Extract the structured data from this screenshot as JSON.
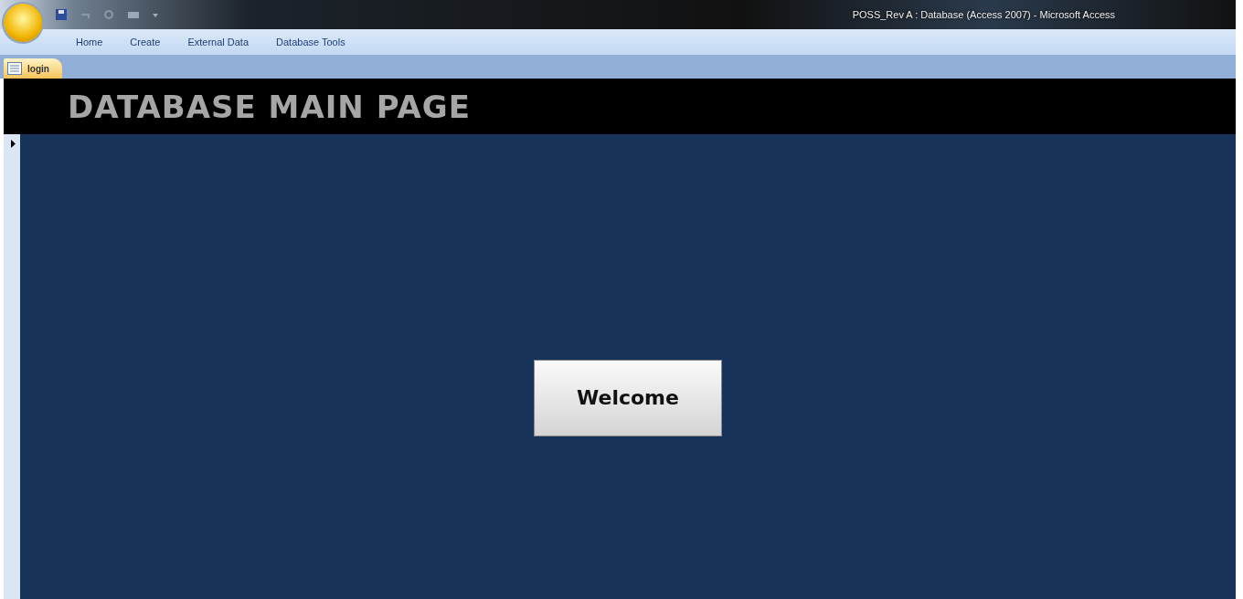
{
  "window": {
    "title": "POSS_Rev A : Database (Access 2007) - Microsoft Access"
  },
  "ribbon_tabs": [
    {
      "label": "Home",
      "selected": false
    },
    {
      "label": "Create",
      "selected": false
    },
    {
      "label": "External Data",
      "selected": false
    },
    {
      "label": "Database Tools",
      "selected": false
    }
  ],
  "document_tabs": [
    {
      "label": "login",
      "selected": true
    }
  ],
  "form": {
    "header": "DATABASE MAIN PAGE",
    "buttons": [
      "Welcome"
    ]
  }
}
